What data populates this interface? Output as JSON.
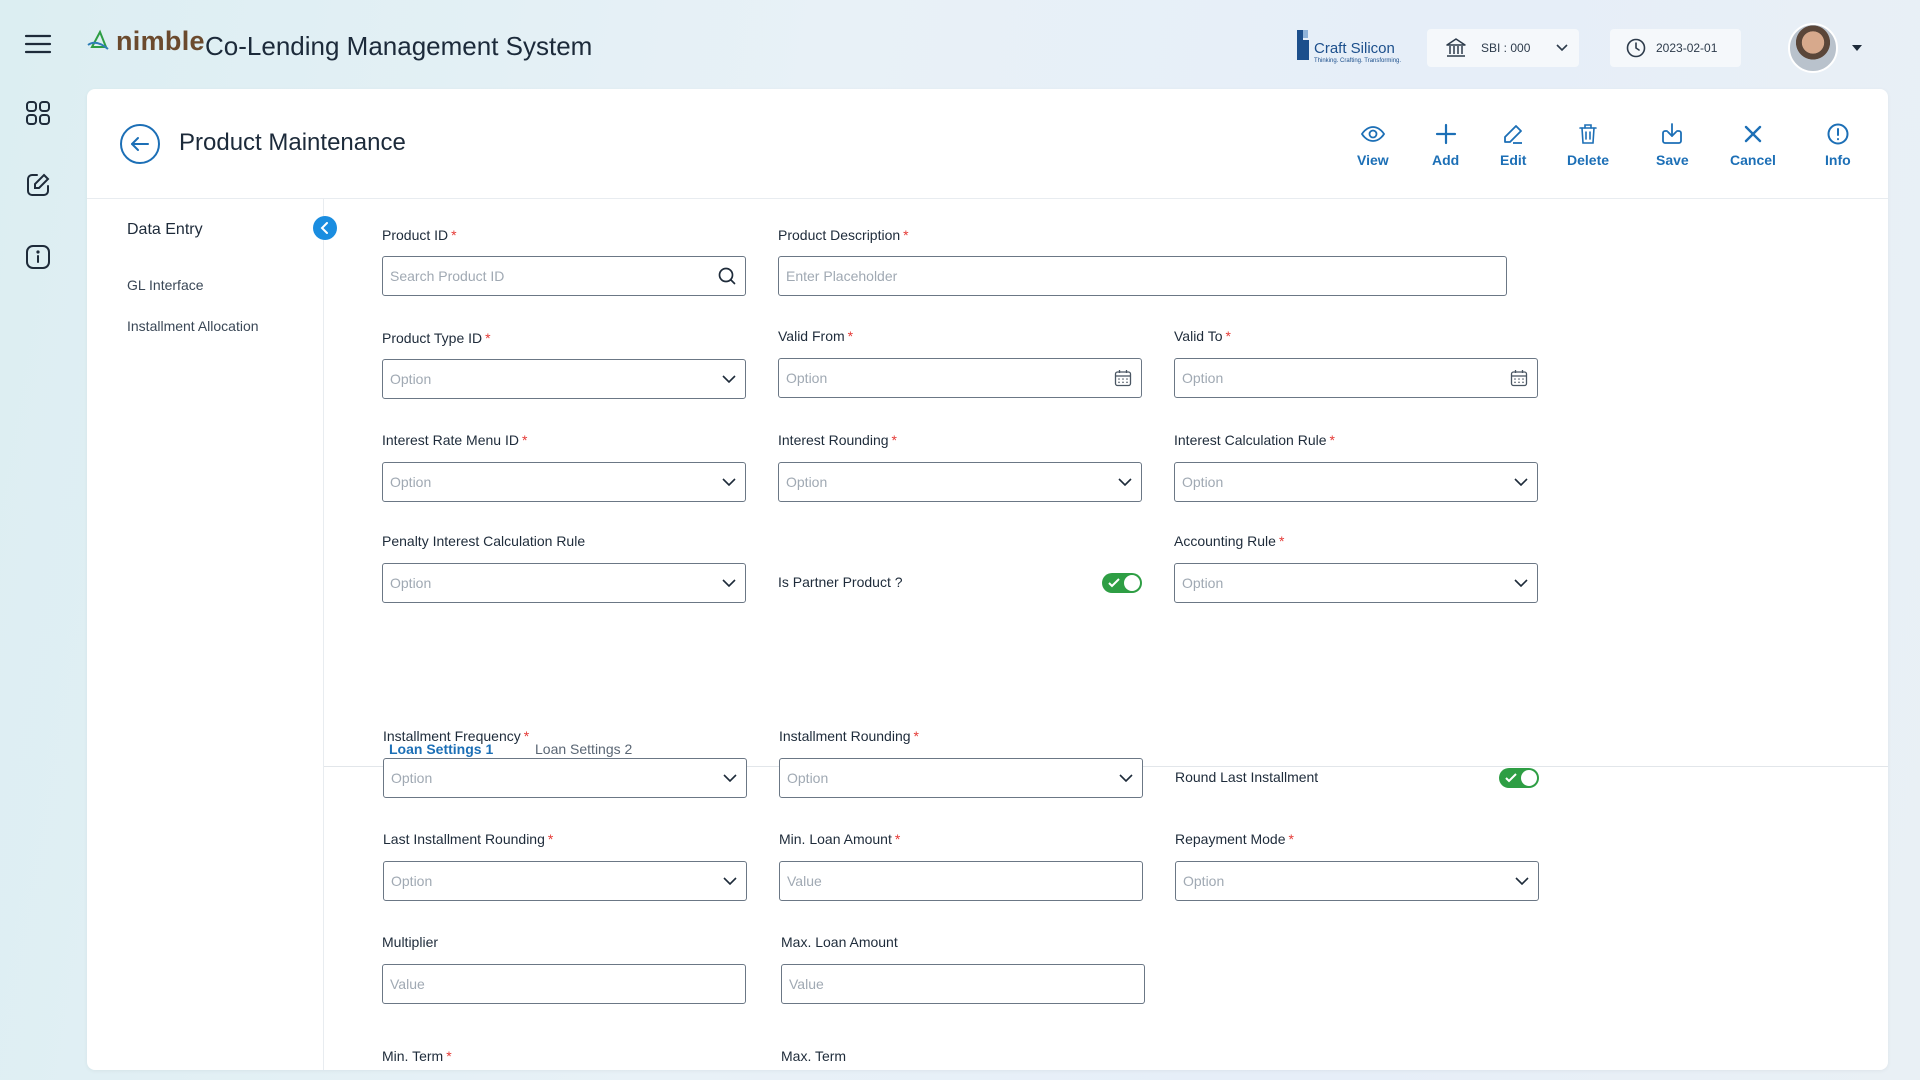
{
  "app": {
    "logo_text": "nimble",
    "title": "Co-Lending Management System"
  },
  "header": {
    "brand_name": "Craft Silicon",
    "brand_tagline": "Thinking. Crafting. Transforming.",
    "branch": "SBI : 000",
    "date": "2023-02-01"
  },
  "page": {
    "title": "Product Maintenance"
  },
  "toolbar": {
    "view": "View",
    "add": "Add",
    "edit": "Edit",
    "delete": "Delete",
    "save": "Save",
    "cancel": "Cancel",
    "info": "Info"
  },
  "left_nav": {
    "section_title": "Data Entry",
    "items": [
      {
        "label": "GL Interface"
      },
      {
        "label": "Installment Allocation"
      }
    ]
  },
  "form": {
    "product_id": {
      "label": "Product ID",
      "placeholder": "Search Product ID",
      "required": "*"
    },
    "product_description": {
      "label": "Product Description",
      "placeholder": "Enter Placeholder",
      "required": "*"
    },
    "product_type_id": {
      "label": "Product Type ID",
      "value": "Option",
      "required": "*"
    },
    "valid_from": {
      "label": "Valid From",
      "value": "Option",
      "required": "*"
    },
    "valid_to": {
      "label": "Valid To",
      "value": "Option",
      "required": "*"
    },
    "interest_rate_menu_id": {
      "label": "Interest Rate Menu ID",
      "value": "Option",
      "required": "*"
    },
    "interest_rounding": {
      "label": "Interest Rounding",
      "value": "Option",
      "required": "*"
    },
    "interest_calculation_rule": {
      "label": "Interest Calculation Rule",
      "value": "Option",
      "required": "*"
    },
    "penalty_interest_calculation_rule": {
      "label": "Penalty Interest Calculation Rule",
      "value": "Option"
    },
    "is_partner_product": {
      "label": "Is Partner Product ?",
      "checked": true
    },
    "accounting_rule": {
      "label": "Accounting Rule",
      "value": "Option",
      "required": "*"
    }
  },
  "tabs": [
    {
      "label": "Loan Settings 1",
      "active": true
    },
    {
      "label": "Loan Settings 2",
      "active": false
    }
  ],
  "loan_settings": {
    "installment_frequency": {
      "label": "Installment Frequency",
      "value": "Option",
      "required": "*"
    },
    "installment_rounding": {
      "label": "Installment Rounding",
      "value": "Option",
      "required": "*"
    },
    "round_last_installment": {
      "label": "Round Last Installment",
      "checked": true
    },
    "last_installment_rounding": {
      "label": "Last Installment Rounding",
      "value": "Option",
      "required": "*"
    },
    "min_loan_amount": {
      "label": "Min. Loan Amount",
      "value": "Value",
      "required": "*"
    },
    "repayment_mode": {
      "label": "Repayment Mode",
      "value": "Option",
      "required": "*"
    },
    "multiplier": {
      "label": "Multiplier",
      "value": "Value"
    },
    "max_loan_amount": {
      "label": "Max. Loan Amount",
      "value": "Value"
    },
    "min_term": {
      "label": "Min. Term",
      "required": "*"
    },
    "max_term": {
      "label": "Max. Term"
    }
  },
  "colors": {
    "accent": "#1c6fb6",
    "toggle_on": "#2e9e44",
    "required": "#e53935",
    "collapse": "#1a8de0"
  }
}
